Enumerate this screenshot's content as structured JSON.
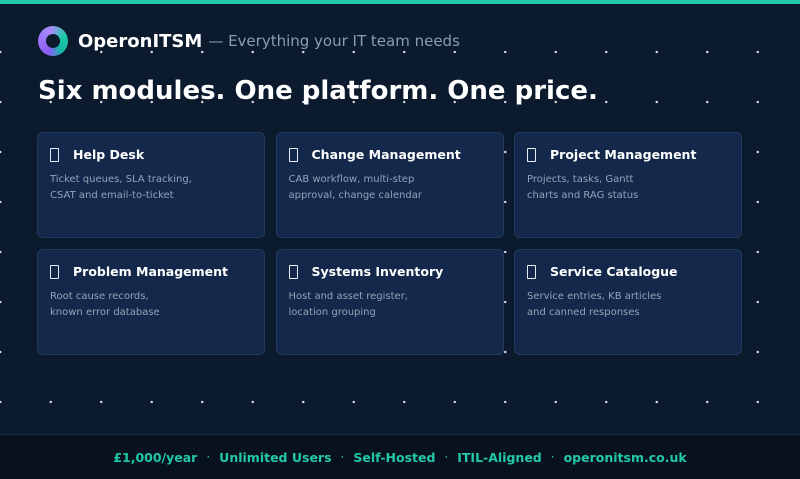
{
  "brand": {
    "name": "OperonITSM",
    "tagline": "— Everything your IT team needs"
  },
  "headline": "Six modules. One platform. One price.",
  "modules": [
    {
      "icon": "module-icon",
      "title": "Help Desk",
      "description": "Ticket queues, SLA tracking,\nCSAT and email-to-ticket"
    },
    {
      "icon": "module-icon",
      "title": "Change Management",
      "description": "CAB workflow, multi-step\napproval, change calendar"
    },
    {
      "icon": "module-icon",
      "title": "Project Management",
      "description": "Projects, tasks, Gantt\ncharts and RAG status"
    },
    {
      "icon": "module-icon",
      "title": "Problem Management",
      "description": "Root cause records,\nknown error database"
    },
    {
      "icon": "module-icon",
      "title": "Systems Inventory",
      "description": "Host and asset register,\nlocation grouping"
    },
    {
      "icon": "module-icon",
      "title": "Service Catalogue",
      "description": "Service entries, KB articles\nand canned responses"
    }
  ],
  "footer": {
    "items": [
      "£1,000/year",
      "Unlimited Users",
      "Self-Hosted",
      "ITIL-Aligned",
      "operonitsm.co.uk"
    ],
    "separator": "·"
  },
  "colors": {
    "background": "#0c1a2e",
    "accent": "#22c9a8",
    "card": "#13284a"
  }
}
